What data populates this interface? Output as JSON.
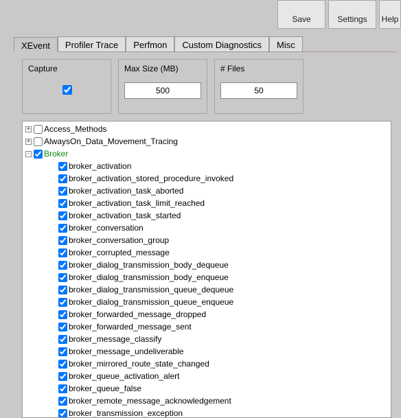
{
  "toolbar": {
    "save": "Save",
    "settings": "Settings",
    "help": "Help"
  },
  "tabs": [
    {
      "label": "XEvent",
      "active": true
    },
    {
      "label": "Profiler Trace",
      "active": false
    },
    {
      "label": "Perfmon",
      "active": false
    },
    {
      "label": "Custom Diagnostics",
      "active": false
    },
    {
      "label": "Misc",
      "active": false
    }
  ],
  "fields": {
    "capture_label": "Capture",
    "capture_checked": true,
    "maxsize_label": "Max Size (MB)",
    "maxsize_value": "500",
    "files_label": "# Files",
    "files_value": "50"
  },
  "tree": [
    {
      "level": 1,
      "exp": "+",
      "checked": false,
      "label": "Access_Methods"
    },
    {
      "level": 1,
      "exp": "+",
      "checked": false,
      "label": "AlwaysOn_Data_Movement_Tracing"
    },
    {
      "level": 1,
      "exp": "-",
      "checked": true,
      "label": "Broker",
      "green": true
    },
    {
      "level": 2,
      "exp": "",
      "checked": true,
      "label": "broker_activation"
    },
    {
      "level": 2,
      "exp": "",
      "checked": true,
      "label": "broker_activation_stored_procedure_invoked"
    },
    {
      "level": 2,
      "exp": "",
      "checked": true,
      "label": "broker_activation_task_aborted"
    },
    {
      "level": 2,
      "exp": "",
      "checked": true,
      "label": "broker_activation_task_limit_reached"
    },
    {
      "level": 2,
      "exp": "",
      "checked": true,
      "label": "broker_activation_task_started"
    },
    {
      "level": 2,
      "exp": "",
      "checked": true,
      "label": "broker_conversation"
    },
    {
      "level": 2,
      "exp": "",
      "checked": true,
      "label": "broker_conversation_group"
    },
    {
      "level": 2,
      "exp": "",
      "checked": true,
      "label": "broker_corrupted_message"
    },
    {
      "level": 2,
      "exp": "",
      "checked": true,
      "label": "broker_dialog_transmission_body_dequeue"
    },
    {
      "level": 2,
      "exp": "",
      "checked": true,
      "label": "broker_dialog_transmission_body_enqueue"
    },
    {
      "level": 2,
      "exp": "",
      "checked": true,
      "label": "broker_dialog_transmission_queue_dequeue"
    },
    {
      "level": 2,
      "exp": "",
      "checked": true,
      "label": "broker_dialog_transmission_queue_enqueue"
    },
    {
      "level": 2,
      "exp": "",
      "checked": true,
      "label": "broker_forwarded_message_dropped"
    },
    {
      "level": 2,
      "exp": "",
      "checked": true,
      "label": "broker_forwarded_message_sent"
    },
    {
      "level": 2,
      "exp": "",
      "checked": true,
      "label": "broker_message_classify"
    },
    {
      "level": 2,
      "exp": "",
      "checked": true,
      "label": "broker_message_undeliverable"
    },
    {
      "level": 2,
      "exp": "",
      "checked": true,
      "label": "broker_mirrored_route_state_changed"
    },
    {
      "level": 2,
      "exp": "",
      "checked": true,
      "label": "broker_queue_activation_alert"
    },
    {
      "level": 2,
      "exp": "",
      "checked": true,
      "label": "broker_queue_false"
    },
    {
      "level": 2,
      "exp": "",
      "checked": true,
      "label": "broker_remote_message_acknowledgement"
    },
    {
      "level": 2,
      "exp": "",
      "checked": true,
      "label": "broker_transmission_exception"
    }
  ]
}
